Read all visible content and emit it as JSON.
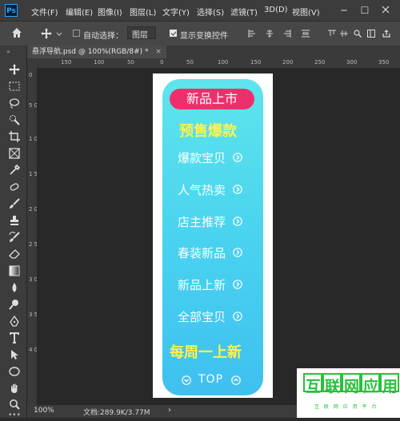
{
  "menubar": {
    "logo": "Ps",
    "items": [
      "文件(F)",
      "编辑(E)",
      "图像(I)",
      "图层(L)",
      "文字(Y)",
      "选择(S)",
      "滤镜(T)",
      "3D(D)",
      "视图(V)"
    ],
    "minimize": "─",
    "maximize": "☐"
  },
  "options": {
    "auto_select_label": "自动选择：",
    "auto_select_checked": false,
    "layer_select": "图层",
    "transform_label": "显示变换控件",
    "transform_checked": true
  },
  "tab": {
    "title": "悬浮导航.psd @ 100%(RGB/8#) *",
    "close": "×"
  },
  "rulers": {
    "h": [
      "150",
      "100",
      "50",
      "0",
      "50",
      "100",
      "150",
      "200",
      "250",
      "300",
      "350"
    ],
    "v": [
      "0",
      "5 0",
      "1 0 0",
      "1 5 0",
      "2 0 0",
      "2 5 0",
      "3 0 0",
      "3 5 0",
      "4 0 0"
    ]
  },
  "banner": {
    "pill": "新品上市",
    "presale": "预售爆款",
    "items": [
      "爆款宝贝",
      "人气热卖",
      "店主推荐",
      "春装新品",
      "新品上新",
      "全部宝贝"
    ],
    "weekly": "每周一上新",
    "top": "TOP"
  },
  "status": {
    "zoom": "100%",
    "doc": "文档:289.9K/3.77M",
    "arrow": "›"
  },
  "watermark": {
    "chars": [
      "互",
      "联",
      "网",
      "应",
      "用"
    ],
    "sub": "互 联 网 应 用 平 台"
  },
  "colors": {
    "banner_top": "#5ee5ec",
    "banner_bottom": "#3fc0f0",
    "pill": "#ef2f6b",
    "accent_yellow": "#fff24a",
    "watermark_green": "#27c13a"
  }
}
